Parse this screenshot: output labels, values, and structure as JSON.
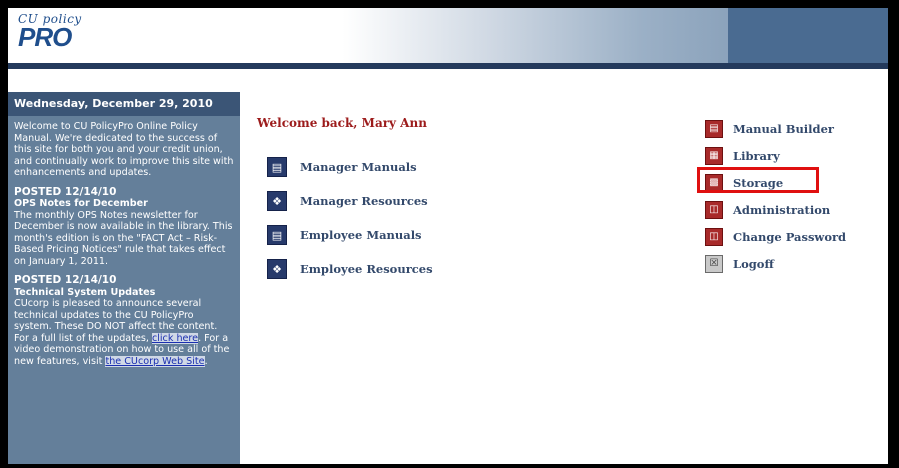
{
  "logo": {
    "small": "CU policy",
    "big": "PRO"
  },
  "sidebar": {
    "date": "Wednesday, December 29, 2010",
    "intro": "Welcome to CU PolicyPro Online Policy Manual. We're dedicated to the success of this site for both you and your credit union, and continually work to improve this site with enhancements and updates.",
    "post1": {
      "posted": "POSTED 12/14/10",
      "title": "OPS Notes for December",
      "body": "The monthly OPS Notes newsletter for December is now available in the library. This month's edition is on the \"FACT Act – Risk-Based Pricing Notices\" rule that takes effect on January 1, 2011."
    },
    "post2": {
      "posted": "POSTED 12/14/10",
      "title": "Technical System Updates",
      "body_pre": "CUcorp is pleased to announce several technical updates to the CU PolicyPro system. These DO NOT affect the content. For a full list of the updates, ",
      "link1": "click here",
      "body_mid": ". For a video demonstration on how to use all of the new features, visit ",
      "link2": "the CUcorp Web Site",
      "body_end": "."
    }
  },
  "welcome": "Welcome back, Mary Ann",
  "nav": {
    "manager_manuals": "Manager Manuals",
    "manager_resources": "Manager Resources",
    "employee_manuals": "Employee Manuals",
    "employee_resources": "Employee Resources"
  },
  "right_menu": {
    "manual_builder": "Manual Builder",
    "library": "Library",
    "storage": "Storage",
    "administration": "Administration",
    "change_password": "Change Password",
    "logoff": "Logoff"
  },
  "colors": {
    "highlight": "#e01010",
    "sidebar_bg": "#647f9a",
    "welcome": "#9c1b1b"
  },
  "icons": {
    "manual": "book-icon",
    "resource": "lightbulb-icon",
    "manual_builder": "book-icon",
    "library": "bookshelf-icon",
    "storage": "storage-icon",
    "administration": "org-chart-icon",
    "logoff": "logoff-icon"
  }
}
